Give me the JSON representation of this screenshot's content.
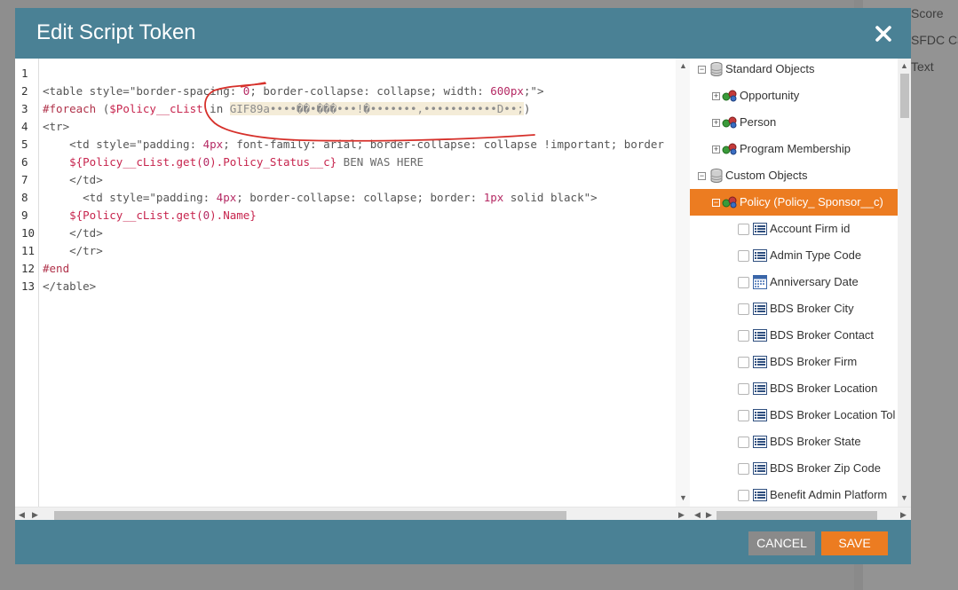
{
  "background": {
    "labels": [
      "Score",
      "SFDC Ca",
      "Text"
    ]
  },
  "dialog": {
    "title": "Edit Script Token",
    "close_label": "✕"
  },
  "editor": {
    "line_numbers": [
      "1",
      "2",
      "3",
      "4",
      "5",
      "6",
      "7",
      "8",
      "9",
      "10",
      "11",
      "12",
      "13"
    ],
    "lines": [
      [],
      [
        [
          "<table style=\"border-spacing: ",
          "plain"
        ],
        [
          "0",
          "num"
        ],
        [
          ";",
          "plain"
        ],
        [
          " border-collapse: collapse; width: ",
          "plain"
        ],
        [
          "600px",
          "num"
        ],
        [
          ";\">",
          "plain"
        ]
      ],
      [
        [
          "#foreach",
          "kw"
        ],
        [
          " (",
          "plain"
        ],
        [
          "$Policy__cList",
          "red"
        ],
        [
          " in ",
          "plain"
        ],
        [
          "GIF89a••••��•���•••!�•••••••,•••••••••••D••;",
          "bin"
        ],
        [
          ")",
          "plain"
        ]
      ],
      [
        [
          "<tr>",
          "plain"
        ]
      ],
      [
        [
          "    <td style=\"padding: ",
          "plain"
        ],
        [
          "4px",
          "num"
        ],
        [
          "; font-family: arial; border-collapse: collapse !important; border",
          "plain"
        ]
      ],
      [
        [
          "    ",
          "plain"
        ],
        [
          "${Policy__cList.get(",
          "red"
        ],
        [
          "0",
          "num"
        ],
        [
          ").Policy_Status__c}",
          "red"
        ],
        [
          " BEN WAS HERE",
          "gray"
        ]
      ],
      [
        [
          "    </td>",
          "plain"
        ]
      ],
      [
        [
          "      <td style=\"padding: ",
          "plain"
        ],
        [
          "4px",
          "num"
        ],
        [
          "; border-collapse: collapse; border: ",
          "plain"
        ],
        [
          "1px",
          "num"
        ],
        [
          " solid black\">",
          "plain"
        ]
      ],
      [
        [
          "    ",
          "plain"
        ],
        [
          "${Policy__cList.get(",
          "red"
        ],
        [
          "0",
          "num"
        ],
        [
          ").Name}",
          "red"
        ]
      ],
      [
        [
          "    </td>",
          "plain"
        ]
      ],
      [
        [
          "    </tr>",
          "plain"
        ]
      ],
      [
        [
          "#end",
          "kw"
        ]
      ],
      [
        [
          "</table>",
          "plain"
        ]
      ]
    ]
  },
  "tree": {
    "items": [
      {
        "label": "Standard Objects",
        "type": "group",
        "level": 0,
        "expander": "⊟"
      },
      {
        "label": "Opportunity",
        "type": "object",
        "level": 1,
        "expander": "⊞"
      },
      {
        "label": "Person",
        "type": "object",
        "level": 1,
        "expander": "⊞"
      },
      {
        "label": "Program Membership",
        "type": "object",
        "level": 1,
        "expander": "⊞"
      },
      {
        "label": "Custom Objects",
        "type": "group",
        "level": 0,
        "expander": "⊟"
      },
      {
        "label": "Policy (Policy_ Sponsor__c)",
        "type": "object",
        "level": 1,
        "expander": "⊟",
        "selected": true
      },
      {
        "label": "Account Firm id",
        "type": "field",
        "level": 2
      },
      {
        "label": "Admin Type Code",
        "type": "field",
        "level": 2
      },
      {
        "label": "Anniversary Date",
        "type": "date",
        "level": 2
      },
      {
        "label": "BDS Broker City",
        "type": "field",
        "level": 2
      },
      {
        "label": "BDS Broker Contact",
        "type": "field",
        "level": 2
      },
      {
        "label": "BDS Broker Firm",
        "type": "field",
        "level": 2
      },
      {
        "label": "BDS Broker Location",
        "type": "field",
        "level": 2
      },
      {
        "label": "BDS Broker Location Tol",
        "type": "field",
        "level": 2
      },
      {
        "label": "BDS Broker State",
        "type": "field",
        "level": 2
      },
      {
        "label": "BDS Broker Zip Code",
        "type": "field",
        "level": 2
      },
      {
        "label": "Benefit Admin Platform",
        "type": "field",
        "level": 2
      }
    ]
  },
  "footer": {
    "cancel_label": "CANCEL",
    "save_label": "SAVE"
  },
  "colors": {
    "header": "#4a8195",
    "accent": "#ec7c21",
    "cancel": "#8a8a8a"
  }
}
